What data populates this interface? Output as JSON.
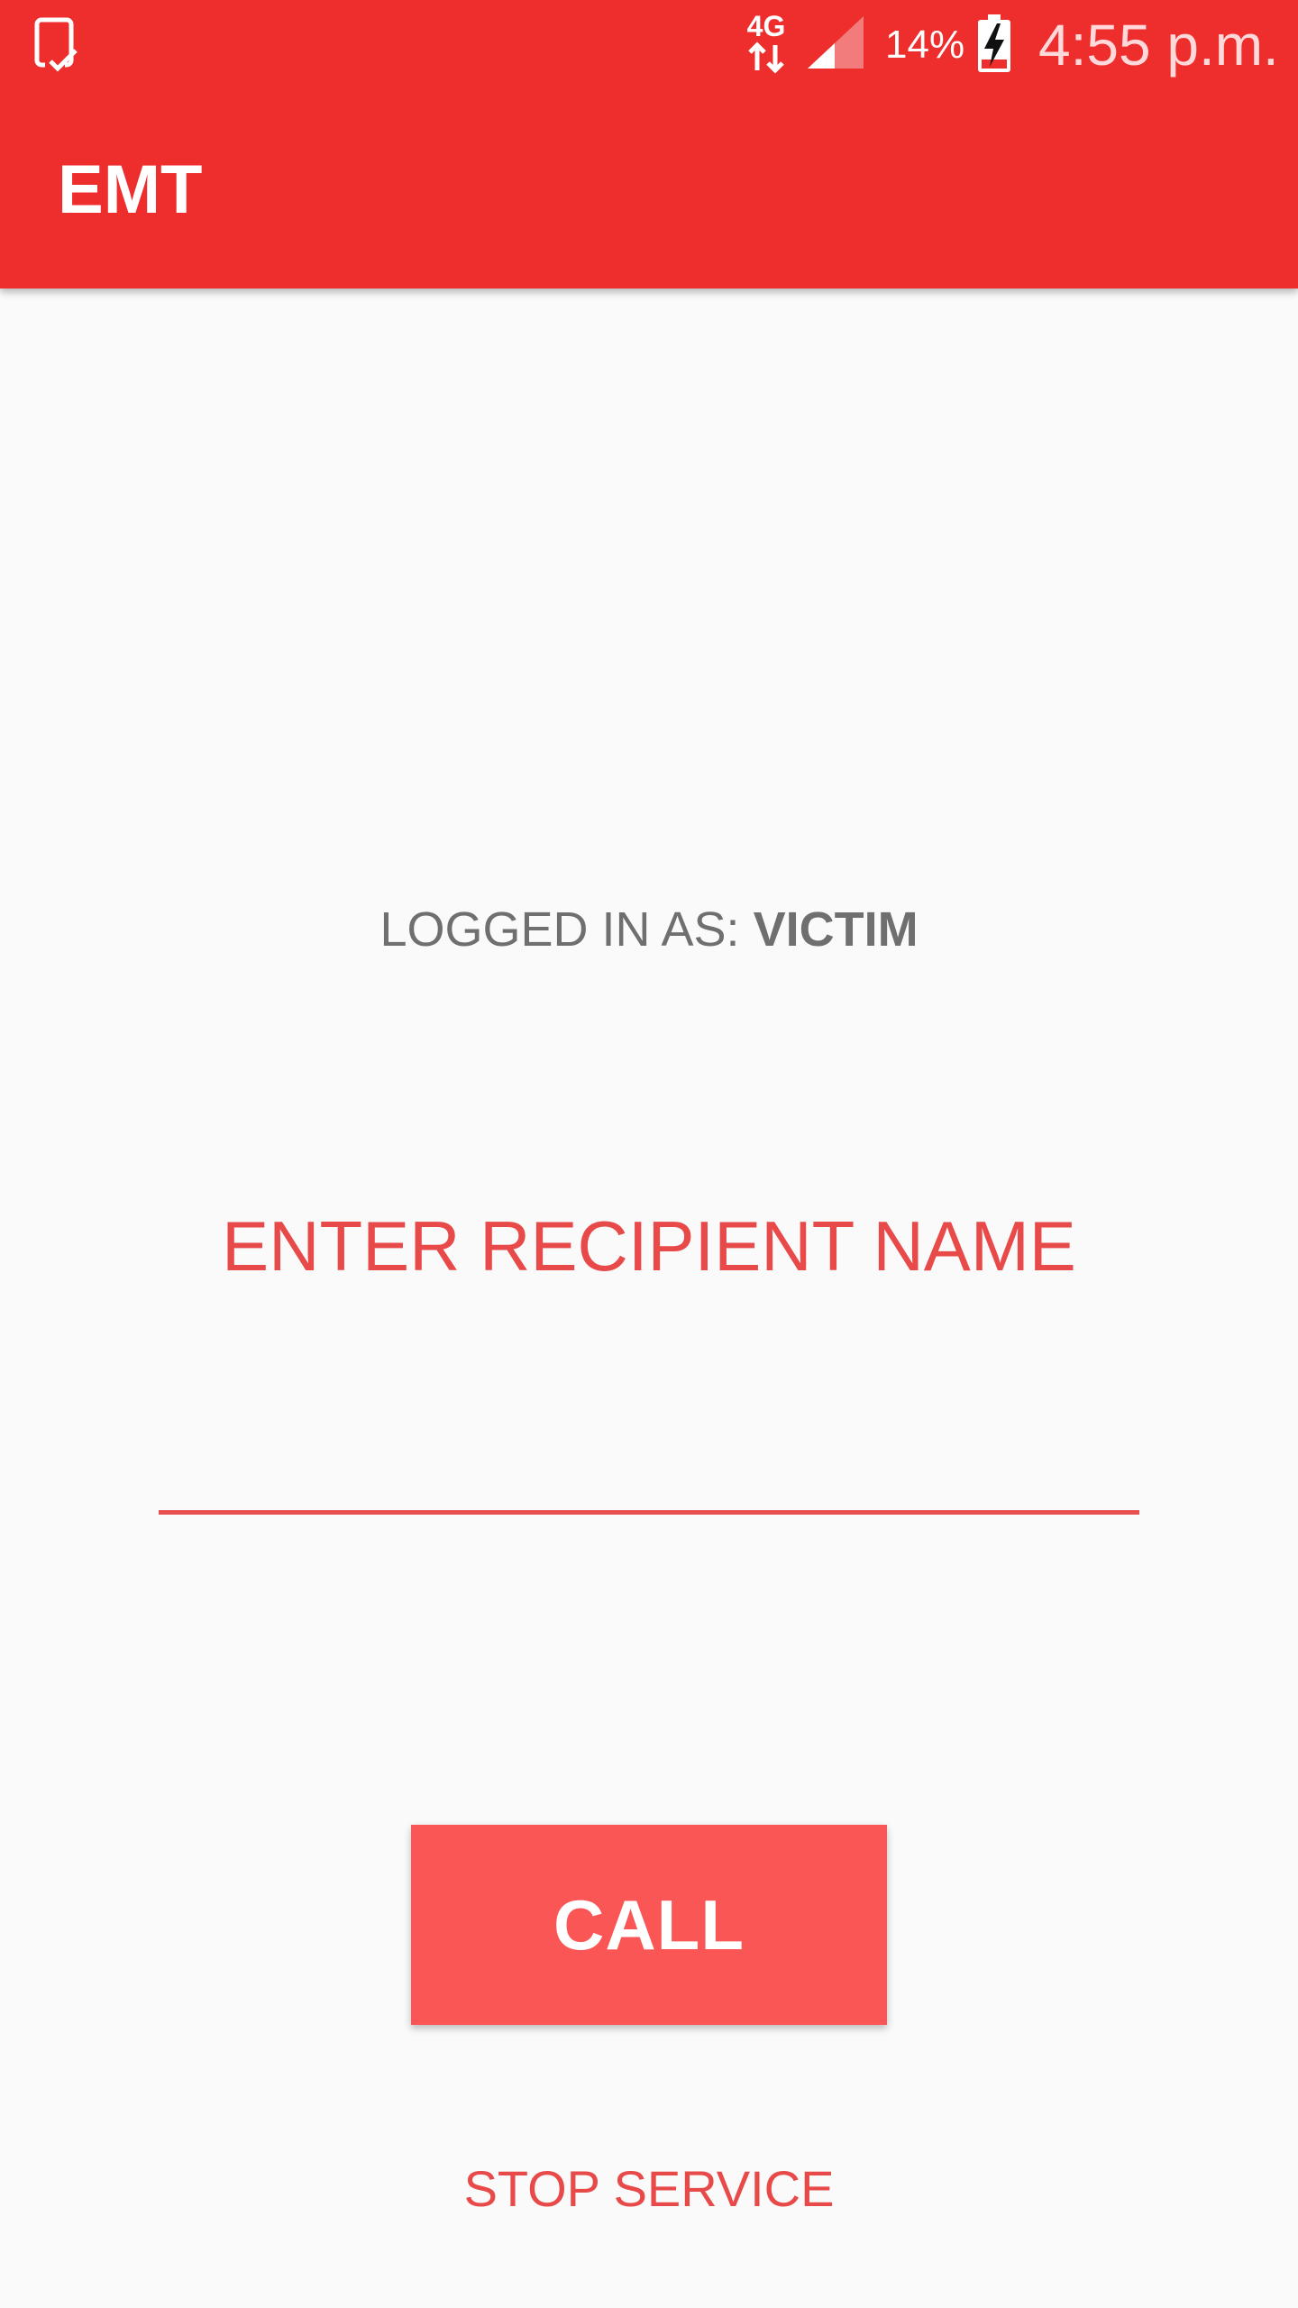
{
  "status_bar": {
    "left_icon": "tablet-check-icon",
    "network_label": "4G",
    "network_icon": "data-transfer-arrows-icon",
    "signal_icon": "cell-signal-icon",
    "battery_percent": "14%",
    "battery_icon": "battery-charging-icon",
    "time": "4:55 p.m."
  },
  "app_bar": {
    "title": "EMT"
  },
  "main": {
    "logged_in_prefix": "LOGGED IN AS: ",
    "logged_in_role": "VICTIM",
    "prompt": "ENTER RECIPIENT NAME",
    "recipient_input": {
      "value": "",
      "placeholder": ""
    },
    "call_label": "CALL",
    "stop_service_label": "STOP SERVICE"
  },
  "colors": {
    "primary": "#ee2d2d",
    "accent": "#e84a4a",
    "button": "#fb5656",
    "background": "#fafafa",
    "text_secondary": "#6f6f6f"
  }
}
